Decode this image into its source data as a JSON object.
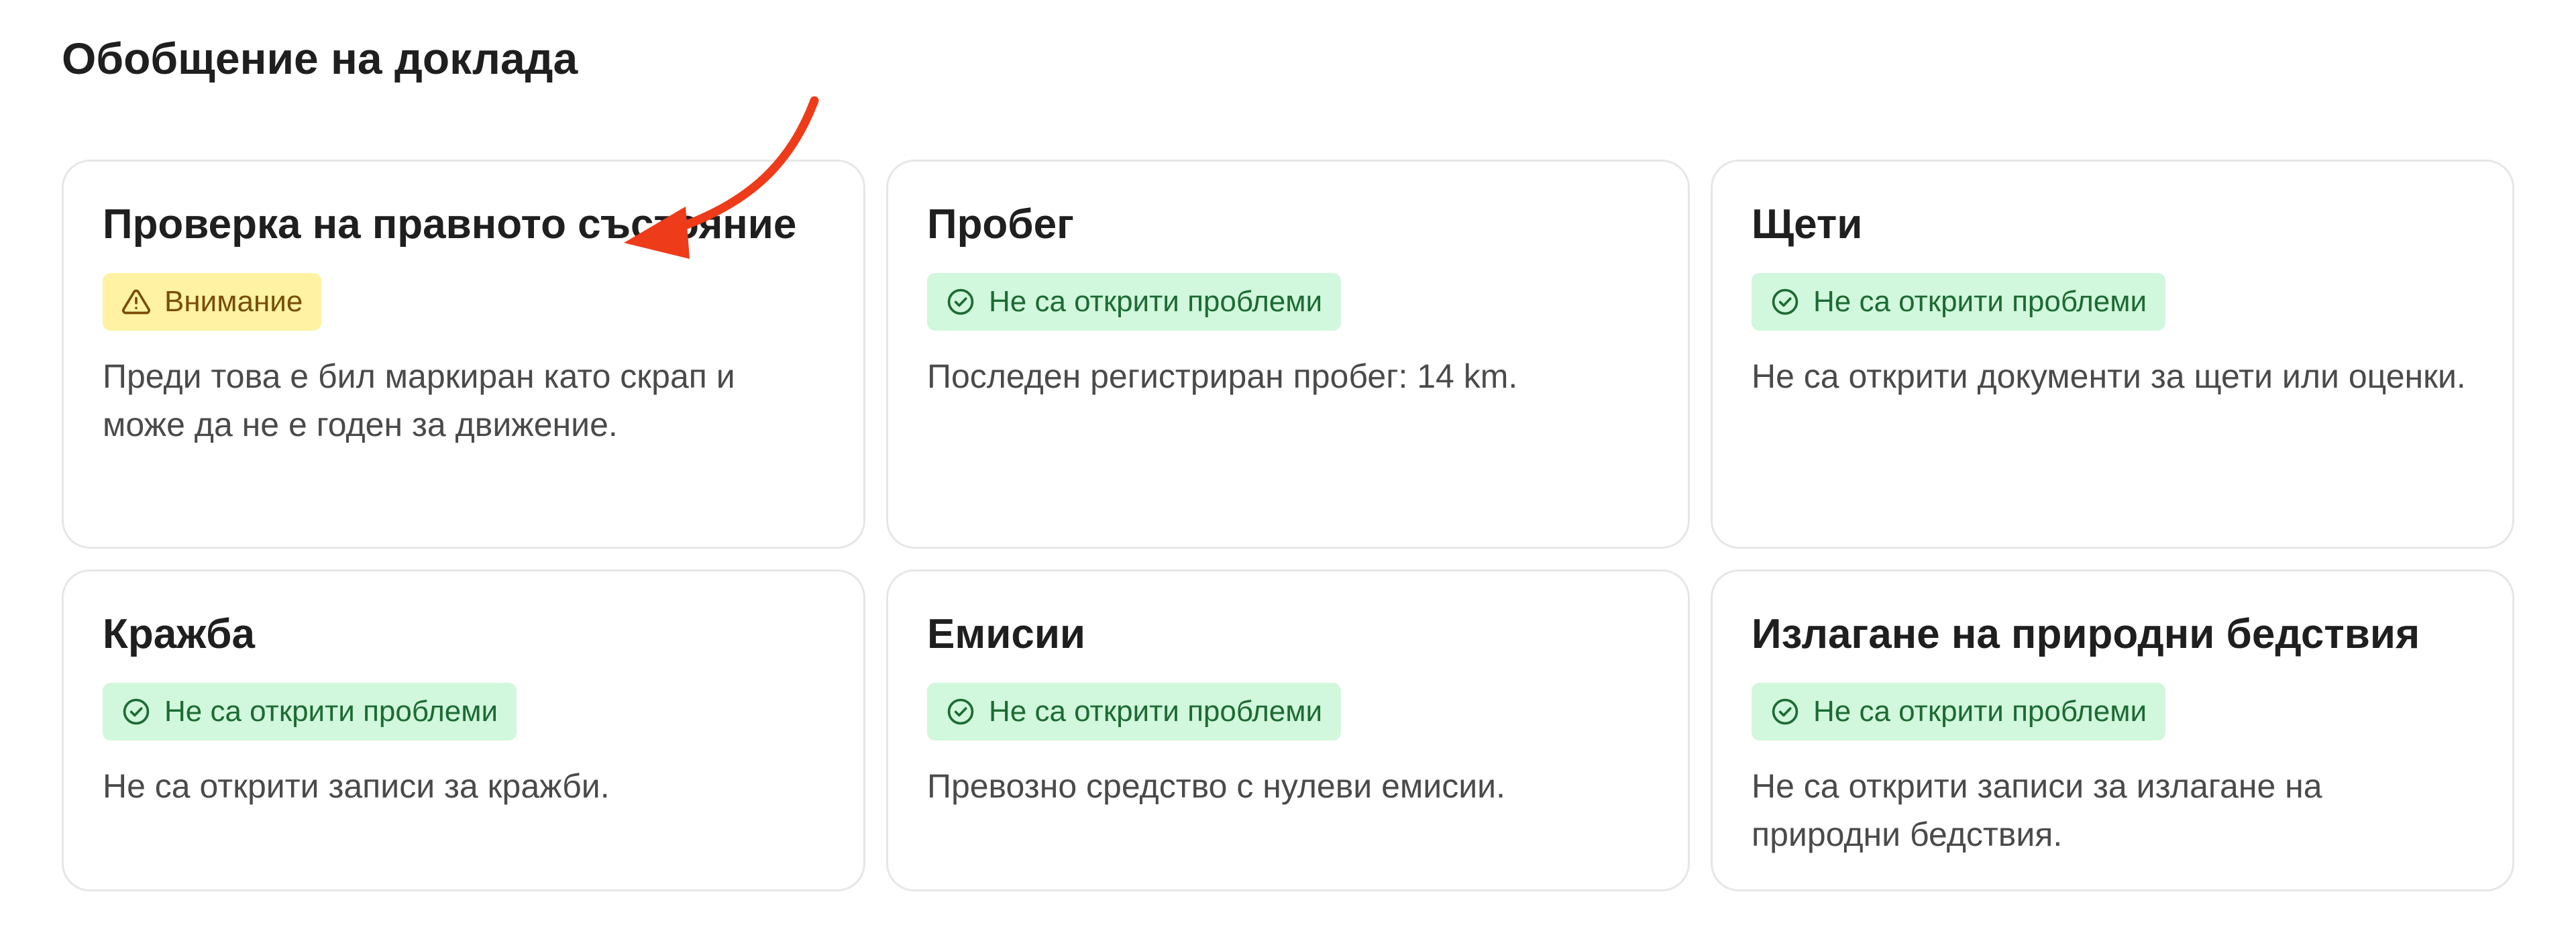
{
  "page": {
    "title": "Обобщение на доклада"
  },
  "cards": [
    {
      "title": "Проверка на правното състояние",
      "status": "Внимание",
      "status_type": "warning",
      "description": "Преди това е бил маркиран като скрап и може да не е годен за движение."
    },
    {
      "title": "Пробег",
      "status": "Не са открити проблеми",
      "status_type": "ok",
      "description": "Последен регистриран пробег: 14 km."
    },
    {
      "title": "Щети",
      "status": "Не са открити проблеми",
      "status_type": "ok",
      "description": "Не са открити документи за щети или оценки."
    },
    {
      "title": "Кражба",
      "status": "Не са открити проблеми",
      "status_type": "ok",
      "description": "Не са открити записи за кражби."
    },
    {
      "title": "Емисии",
      "status": "Не са открити проблеми",
      "status_type": "ok",
      "description": "Превозно средство с нулеви емисии."
    },
    {
      "title": "Излагане на природни бедствия",
      "status": "Не са открити проблеми",
      "status_type": "ok",
      "description": "Не са открити записи за излагане на природни бедствия."
    }
  ],
  "icons": {
    "ok": "check-circle-icon",
    "warning": "warning-triangle-icon",
    "annotation": "arrow-pointer-icon"
  },
  "colors": {
    "ok_bg": "#d1f7dc",
    "ok_text": "#1c6b33",
    "warn_bg": "#fff3a3",
    "warn_text": "#7a4d05",
    "arrow": "#ee3b1a"
  }
}
